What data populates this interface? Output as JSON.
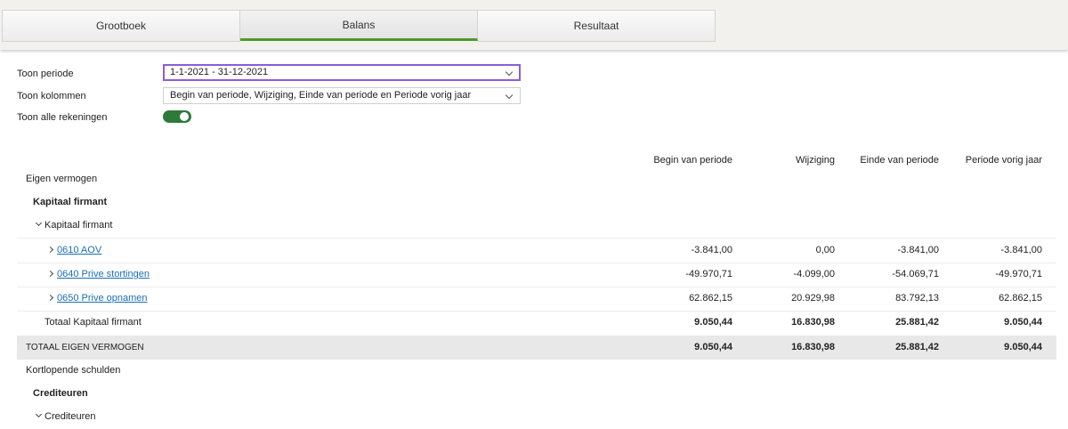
{
  "tabs": [
    {
      "label": "Grootboek",
      "active": false
    },
    {
      "label": "Balans",
      "active": true
    },
    {
      "label": "Resultaat",
      "active": false
    }
  ],
  "filters": {
    "periode_label": "Toon periode",
    "periode_value": "1-1-2021 - 31-12-2021",
    "kolommen_label": "Toon kolommen",
    "kolommen_value": "Begin van periode, Wijziging, Einde van periode en Periode vorig jaar",
    "alle_rekeningen_label": "Toon alle rekeningen",
    "alle_rekeningen_on": true
  },
  "columns": [
    "Begin van periode",
    "Wijziging",
    "Einde van periode",
    "Periode vorig jaar"
  ],
  "sections": {
    "eigen_vermogen": "Eigen vermogen",
    "kapitaal_firmant_group": "Kapitaal firmant",
    "kapitaal_firmant_sub": "Kapitaal firmant",
    "accounts": [
      {
        "label": "0610 AOV",
        "values": [
          "-3.841,00",
          "0,00",
          "-3.841,00",
          "-3.841,00"
        ]
      },
      {
        "label": "0640 Prive stortingen",
        "values": [
          "-49.970,71",
          "-4.099,00",
          "-54.069,71",
          "-49.970,71"
        ]
      },
      {
        "label": "0650 Prive opnamen",
        "values": [
          "62.862,15",
          "20.929,98",
          "83.792,13",
          "62.862,15"
        ]
      }
    ],
    "totaal_kapitaal": {
      "label": "Totaal Kapitaal firmant",
      "values": [
        "9.050,44",
        "16.830,98",
        "25.881,42",
        "9.050,44"
      ]
    },
    "totaal_eigen_vermogen": {
      "label": "TOTAAL EIGEN VERMOGEN",
      "values": [
        "9.050,44",
        "16.830,98",
        "25.881,42",
        "9.050,44"
      ]
    },
    "kortlopende_schulden": "Kortlopende schulden",
    "crediteuren_group": "Crediteuren",
    "crediteuren_sub": "Crediteuren"
  },
  "colors": {
    "accent_green": "#4c9a2a",
    "toggle_green": "#2f7a3b",
    "focus_purple": "#8a5ed6",
    "link_blue": "#1a6fb3"
  }
}
